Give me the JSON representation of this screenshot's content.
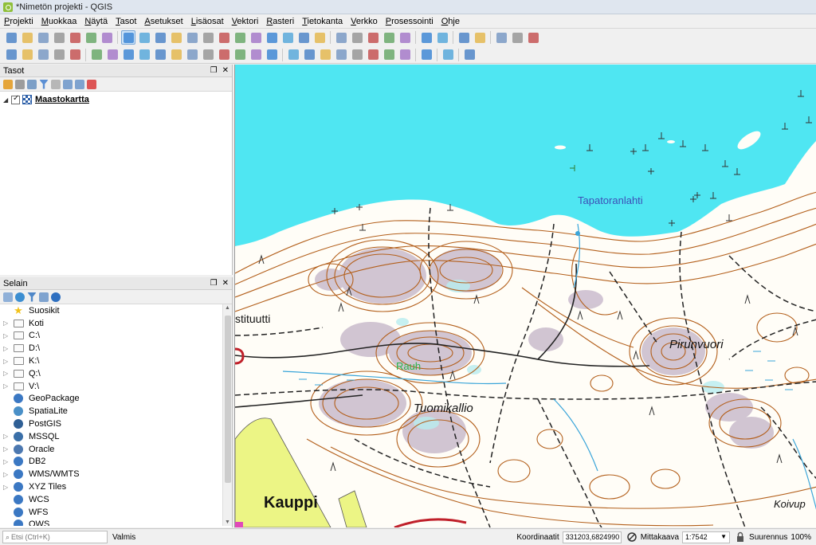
{
  "window": {
    "title": "*Nimetön projekti - QGIS"
  },
  "menu": [
    "Projekti",
    "Muokkaa",
    "Näytä",
    "Tasot",
    "Asetukset",
    "Lisäosat",
    "Vektori",
    "Rasteri",
    "Tietokanta",
    "Verkko",
    "Prosessointi",
    "Ohje"
  ],
  "toolbar1": [
    "new-project-icon",
    "open-project-icon",
    "save-project-icon",
    "save-as-icon",
    "print-layout-icon",
    "layout-manager-icon",
    "style-manager-icon",
    "pan-icon",
    "pan-to-selection-icon",
    "zoom-in-icon",
    "zoom-out-icon",
    "zoom-native-icon",
    "zoom-full-icon",
    "zoom-selection-icon",
    "zoom-layer-icon",
    "zoom-last-icon",
    "zoom-next-icon",
    "new-bookmark-icon",
    "show-bookmarks-icon",
    "refresh-icon",
    "identify-icon",
    "run-action-icon",
    "select-features-icon",
    "select-by-value-icon",
    "deselect-icon",
    "attribute-table-icon",
    "field-calculator-icon",
    "toolbox-icon",
    "statistics-icon",
    "measure-icon",
    "annotation-icon",
    "text-annotation-icon"
  ],
  "toolbar2": [
    "add-vector-icon",
    "add-raster-icon",
    "add-delimited-icon",
    "add-spatialite-icon",
    "add-wms-icon",
    "current-edits-icon",
    "toggle-editing-icon",
    "save-edits-icon",
    "digitize-icon",
    "vertex-tool-icon",
    "modify-attributes-icon",
    "delete-selected-icon",
    "cut-features-icon",
    "copy-features-icon",
    "paste-features-icon",
    "undo-icon",
    "redo-icon",
    "label-toolbar-icon",
    "layer-diagram-icon",
    "highlight-label-icon",
    "pin-label-icon",
    "show-hide-label-icon",
    "move-label-icon",
    "rotate-label-icon",
    "change-label-icon",
    "globe-icon",
    "python-icon",
    "help-icon"
  ],
  "layers_panel": {
    "title": "Tasot",
    "layer": {
      "name": "Maastokartta",
      "checked": true
    }
  },
  "browser_panel": {
    "title": "Selain",
    "items": [
      {
        "label": "Suosikit",
        "icon": "star-icon",
        "expandable": false
      },
      {
        "label": "Koti",
        "icon": "home-folder-icon",
        "expandable": true
      },
      {
        "label": "C:\\",
        "icon": "folder-icon",
        "expandable": true
      },
      {
        "label": "D:\\",
        "icon": "folder-icon",
        "expandable": true
      },
      {
        "label": "K:\\",
        "icon": "folder-icon",
        "expandable": true
      },
      {
        "label": "Q:\\",
        "icon": "folder-icon",
        "expandable": true
      },
      {
        "label": "V:\\",
        "icon": "folder-icon",
        "expandable": true
      },
      {
        "label": "GeoPackage",
        "icon": "geopackage-icon",
        "expandable": false
      },
      {
        "label": "SpatiaLite",
        "icon": "spatialite-icon",
        "expandable": false
      },
      {
        "label": "PostGIS",
        "icon": "postgis-icon",
        "expandable": false
      },
      {
        "label": "MSSQL",
        "icon": "mssql-icon",
        "expandable": true
      },
      {
        "label": "Oracle",
        "icon": "oracle-icon",
        "expandable": true
      },
      {
        "label": "DB2",
        "icon": "db2-icon",
        "expandable": true
      },
      {
        "label": "WMS/WMTS",
        "icon": "wms-icon",
        "expandable": true
      },
      {
        "label": "XYZ Tiles",
        "icon": "xyz-icon",
        "expandable": true
      },
      {
        "label": "WCS",
        "icon": "wcs-icon",
        "expandable": false
      },
      {
        "label": "WFS",
        "icon": "wfs-icon",
        "expandable": false
      },
      {
        "label": "OWS",
        "icon": "ows-icon",
        "expandable": false
      }
    ]
  },
  "map": {
    "labels": [
      "Tapatoranlahti",
      "stituutti",
      "Pirunvuori",
      "Rauh",
      "Tuomikallio",
      "Kauppi",
      "Koivup"
    ],
    "colors": {
      "water": "#4fe6f2",
      "contour": "#b35f1b",
      "paths": "#222222",
      "land": "#fffdf7"
    }
  },
  "status": {
    "search_placeholder": "Etsi (Ctrl+K)",
    "message": "Valmis",
    "coord_label": "Koordinaatit",
    "coord_value": "331203,6824990",
    "scale_label": "Mittakaava",
    "scale_value": "1:7542",
    "magnifier_label": "Suurennus",
    "magnifier_value": "100%"
  }
}
